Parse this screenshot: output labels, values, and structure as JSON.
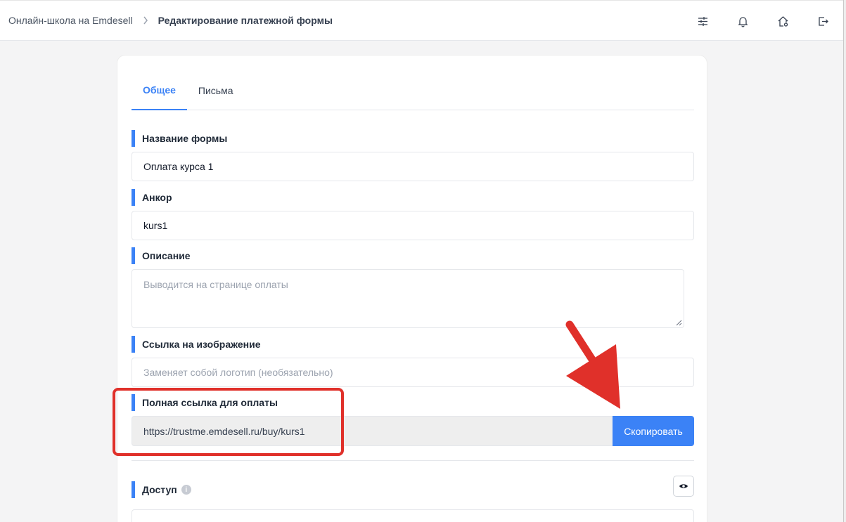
{
  "breadcrumb": {
    "parent": "Онлайн-школа на Emdesell",
    "current": "Редактирование платежной формы"
  },
  "top_icons": [
    "settings-sliders-icon",
    "bell-icon",
    "home-settings-icon",
    "logout-icon"
  ],
  "tabs": [
    {
      "label": "Общее",
      "active": true
    },
    {
      "label": "Письма",
      "active": false
    }
  ],
  "fields": {
    "form_name": {
      "label": "Название формы",
      "value": "Оплата курса 1"
    },
    "anchor": {
      "label": "Анкор",
      "value": "kurs1"
    },
    "description": {
      "label": "Описание",
      "placeholder": "Выводится на странице оплаты"
    },
    "image_link": {
      "label": "Ссылка на изображение",
      "placeholder": "Заменяет собой логотип (необязательно)"
    },
    "payment_link": {
      "label": "Полная ссылка для оплаты",
      "value": "https://trustme.emdesell.ru/buy/kurs1",
      "button": "Скопировать"
    },
    "access": {
      "label": "Доступ",
      "info_icon": "i"
    }
  },
  "colors": {
    "accent": "#3b82f6",
    "annotation": "#e0302a"
  }
}
